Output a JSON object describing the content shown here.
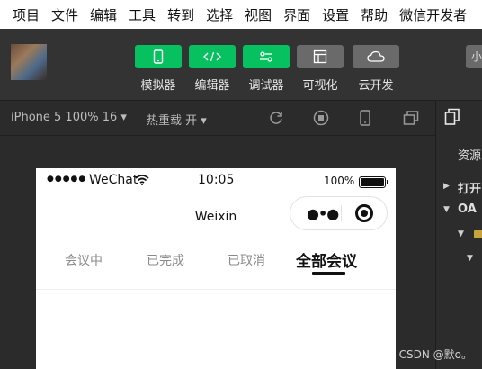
{
  "menu": {
    "items": [
      "项目",
      "文件",
      "编辑",
      "工具",
      "转到",
      "选择",
      "视图",
      "界面",
      "设置",
      "帮助",
      "微信开发者"
    ]
  },
  "toolbar": {
    "tools": [
      {
        "label": "模拟器",
        "icon": "phone-icon",
        "color": "#07c160"
      },
      {
        "label": "编辑器",
        "icon": "code-icon",
        "color": "#07c160"
      },
      {
        "label": "调试器",
        "icon": "debug-toggle-icon",
        "color": "#07c160"
      },
      {
        "label": "可视化",
        "icon": "layout-icon",
        "color": "#6a6a6a"
      },
      {
        "label": "云开发",
        "icon": "cloud-icon",
        "color": "#6a6a6a"
      }
    ],
    "right_button_label": "小"
  },
  "simbar": {
    "device": "iPhone 5 100% 16 ▾",
    "hot_reload": "热重载 开 ▾"
  },
  "phone": {
    "status": {
      "signal": "●●●●●",
      "carrier": "WeChat",
      "time": "10:05",
      "battery": "100%"
    },
    "nav_title": "Weixin",
    "tabs": [
      {
        "label": "会议中",
        "active": false
      },
      {
        "label": "已完成",
        "active": false
      },
      {
        "label": "已取消",
        "active": false
      },
      {
        "label": "全部会议",
        "active": true
      }
    ]
  },
  "right_panel": {
    "resources": "资源",
    "open": "打开",
    "project": "OA"
  },
  "watermark": "CSDN @默o。"
}
